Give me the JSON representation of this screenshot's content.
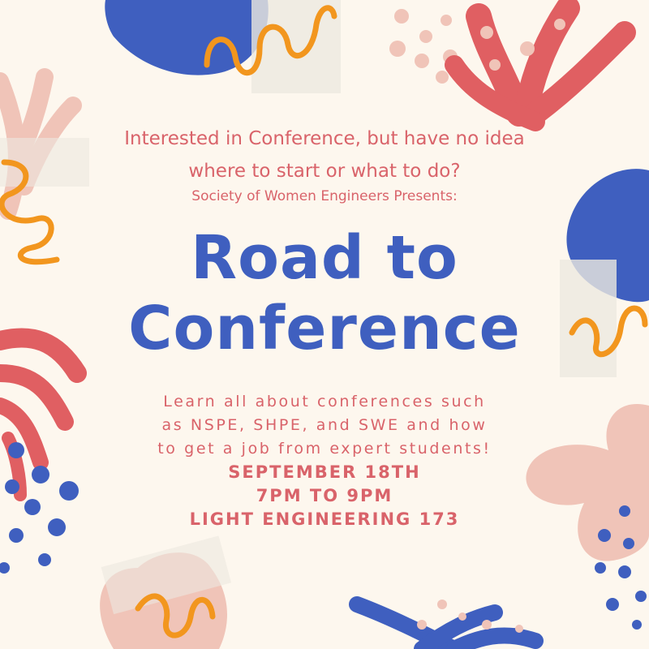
{
  "poster": {
    "intro_line1": "Interested in Conference, but have no idea",
    "intro_line2": "where to start or what to do?",
    "presenter": "Society of Women Engineers Presents:",
    "title_line1": "Road to",
    "title_line2": "Conference",
    "description_line1": "Learn all about conferences such",
    "description_line2": "as NSPE, SHPE, and SWE and how",
    "description_line3": "to get a job from expert students!",
    "date": "SEPTEMBER 18TH",
    "time": "7PM TO 9PM",
    "location": "LIGHT ENGINEERING 173"
  },
  "colors": {
    "background": "#fdf7ee",
    "text": "#d9636a",
    "title": "#3f5fbf",
    "blue": "#3f5fbf",
    "red": "#e05f62",
    "pink": "#f0c4b8",
    "orange": "#f2961e"
  }
}
